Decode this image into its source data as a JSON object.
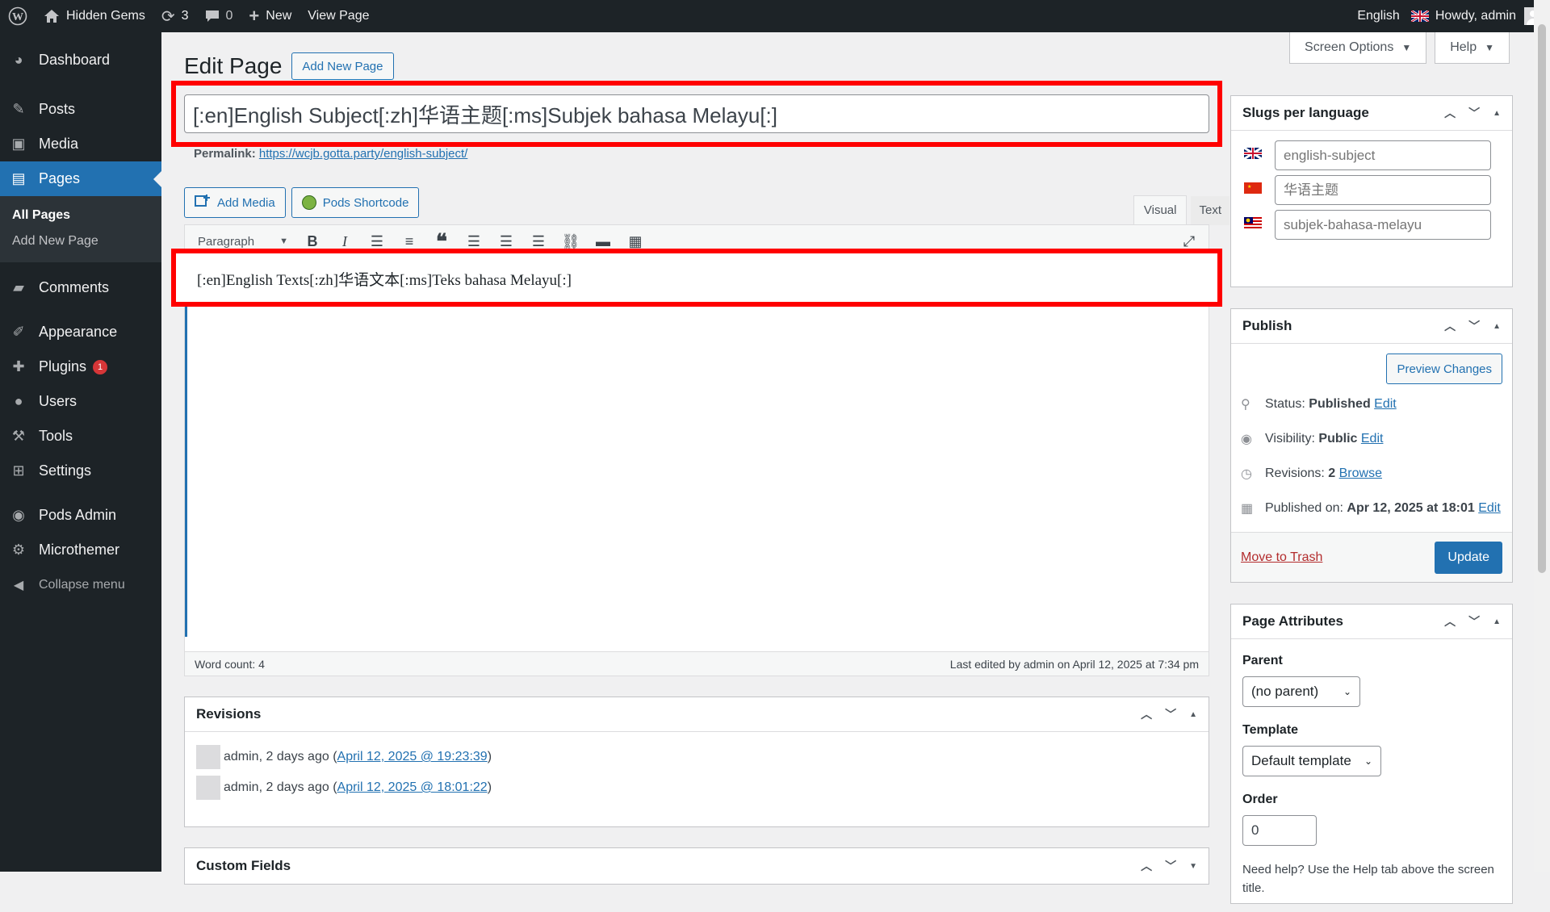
{
  "adminbar": {
    "site_name": "Hidden Gems",
    "updates_count": "3",
    "comments_count": "0",
    "new_label": "New",
    "view_page": "View Page",
    "language": "English",
    "howdy": "Howdy, admin"
  },
  "sidebar": {
    "items": [
      {
        "label": "Dashboard",
        "icon": "dashboard-icon"
      },
      {
        "label": "Posts",
        "icon": "pin-icon"
      },
      {
        "label": "Media",
        "icon": "media-icon"
      },
      {
        "label": "Pages",
        "icon": "pages-icon"
      },
      {
        "label": "Comments",
        "icon": "comment-icon"
      },
      {
        "label": "Appearance",
        "icon": "brush-icon"
      },
      {
        "label": "Plugins",
        "icon": "plugin-icon",
        "badge": "1"
      },
      {
        "label": "Users",
        "icon": "user-icon"
      },
      {
        "label": "Tools",
        "icon": "wrench-icon"
      },
      {
        "label": "Settings",
        "icon": "settings-icon"
      },
      {
        "label": "Pods Admin",
        "icon": "pods-icon"
      },
      {
        "label": "Microthemer",
        "icon": "gear-icon"
      }
    ],
    "submenu": [
      "All Pages",
      "Add New Page"
    ],
    "collapse": "Collapse menu"
  },
  "header": {
    "title": "Edit Page",
    "add_new": "Add New Page",
    "screen_options": "Screen Options",
    "help": "Help"
  },
  "editor": {
    "title_value": "[:en]English Subject[:zh]华语主题[:ms]Subjek bahasa Melayu[:]",
    "permalink_label": "Permalink:",
    "permalink_url": "https://wcjb.gotta.party/english-subject/",
    "add_media": "Add Media",
    "pods_shortcode": "Pods Shortcode",
    "tab_visual": "Visual",
    "tab_text": "Text",
    "format": "Paragraph",
    "content": "[:en]English Texts[:zh]华语文本[:ms]Teks bahasa Melayu[:]",
    "word_count": "Word count: 4",
    "last_edited": "Last edited by admin on April 12, 2025 at 7:34 pm"
  },
  "revisions": {
    "title": "Revisions",
    "items": [
      {
        "author": "admin, 2 days ago (",
        "link": "April 12, 2025 @ 19:23:39",
        "close": ")"
      },
      {
        "author": "admin, 2 days ago (",
        "link": "April 12, 2025 @ 18:01:22",
        "close": ")"
      }
    ]
  },
  "custom_fields": {
    "title": "Custom Fields"
  },
  "slugs": {
    "title": "Slugs per language",
    "en": "english-subject",
    "zh": "华语主题",
    "ms": "subjek-bahasa-melayu"
  },
  "publish": {
    "title": "Publish",
    "preview": "Preview Changes",
    "status_label": "Status:",
    "status_value": "Published",
    "visibility_label": "Visibility:",
    "visibility_value": "Public",
    "revisions_label": "Revisions:",
    "revisions_value": "2",
    "browse": "Browse",
    "published_label": "Published on:",
    "published_value": "Apr 12, 2025 at 18:01",
    "edit": "Edit",
    "trash": "Move to Trash",
    "update": "Update"
  },
  "attributes": {
    "title": "Page Attributes",
    "parent_label": "Parent",
    "parent_value": "(no parent)",
    "template_label": "Template",
    "template_value": "Default template",
    "order_label": "Order",
    "order_value": "0",
    "help": "Need help? Use the Help tab above the screen title."
  },
  "colors": {
    "accent": "#2271b1",
    "highlight": "#ff0000",
    "sidebar": "#1d2327"
  }
}
